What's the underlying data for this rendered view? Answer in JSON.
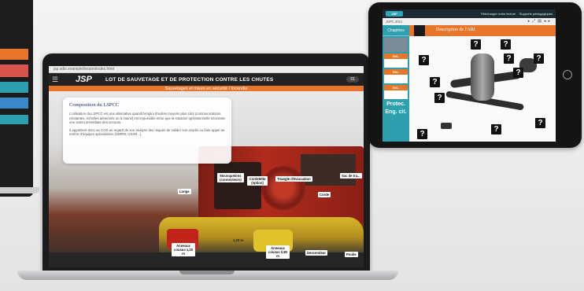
{
  "laptop": {
    "browser_url": "jsp.sdis.example/lesson/index.html",
    "logo_text": "JSP",
    "header_title": "LOT DE SAUVETAGE ET DE PROTECTION CONTRE LES CHUTES",
    "page_badge": "01",
    "sub_banner": "Sauvetages et mises en sécurité / Incendie",
    "card_title": "Composition du LSPCC",
    "card_paragraph_1": "L'utilisation du LSPCC est une alternative quand l'emploi d'autres moyens plus sûrs (communications existantes, échelles aériennes ou à mains) est impossible et/ou que la situation opérationnelle nécessite une action immédiate des secours.",
    "card_paragraph_2": "Il appartient donc au COS au regard de son analyse des risques de valider son emploi ou faire appel au renfort d'équipes spécialisées (SMPM, USAR...).",
    "gear_labels": {
      "longe": "Longe",
      "mousquetons": "Mousquetons (connecteurs)",
      "cordelette": "Cordelette (option)",
      "triangle": "Triangle d'évacuation",
      "sac": "Sac de tra...",
      "corde": "Corde",
      "anneau_1": "Anneaux cousus 1,20 m",
      "anneau_2": "Anneaux cousus 0,80 m",
      "descendeur": "Descendeur",
      "poulie": "Poulie",
      "strap_marker": "1,20 m"
    }
  },
  "tablet": {
    "logo_text": "JSP",
    "top_right_1": "Télécharger notre lecture",
    "top_right_2": "Supports pédagogiques",
    "course_label": "JSPC 2021",
    "chapters_label": "Chapitres",
    "chapter_items": [
      "Inc.",
      "Inc.",
      "Inc."
    ],
    "side_labels": [
      "Protec.",
      "Eng. cit."
    ],
    "banner_title": "Description de l'ARI",
    "question_mark": "?"
  }
}
